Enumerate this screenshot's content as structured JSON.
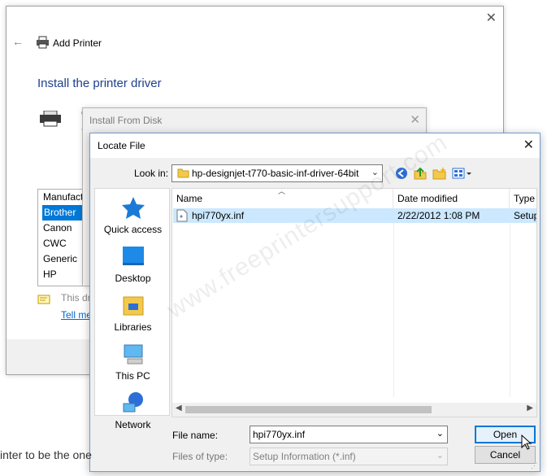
{
  "wizard": {
    "title": "Add Printer",
    "heading": "Install the printer driver",
    "manufacturers_header": "Manufact",
    "manufacturers": [
      "Brother",
      "Canon",
      "CWC",
      "Generic",
      "HP"
    ],
    "selected_manufacturer": "Brother",
    "driver_note": "This dri",
    "tell_link": "Tell me",
    "partial_text_1": "C",
    "partial_text_2": "T"
  },
  "install_from_disk": {
    "title": "Install From Disk"
  },
  "locate_file": {
    "title": "Locate File",
    "look_in_label": "Look in:",
    "look_in_value": "hp-designjet-t770-basic-inf-driver-64bit",
    "places": [
      {
        "label": "Quick access",
        "icon": "star-icon"
      },
      {
        "label": "Desktop",
        "icon": "desktop-icon"
      },
      {
        "label": "Libraries",
        "icon": "libraries-icon"
      },
      {
        "label": "This PC",
        "icon": "computer-icon"
      },
      {
        "label": "Network",
        "icon": "network-icon"
      }
    ],
    "columns": [
      "Name",
      "Date modified",
      "Type"
    ],
    "files": [
      {
        "name": "hpi770yx.inf",
        "date": "2/22/2012 1:08 PM",
        "type": "Setup"
      }
    ],
    "file_name_label": "File name:",
    "file_name_value": "hpi770yx.inf",
    "file_type_label": "Files of type:",
    "file_type_value": "Setup Information (*.inf)",
    "open_label": "Open",
    "cancel_label": "Cancel"
  },
  "watermark": "www.freeprintersupport.com",
  "background_text": "inter to be the one"
}
